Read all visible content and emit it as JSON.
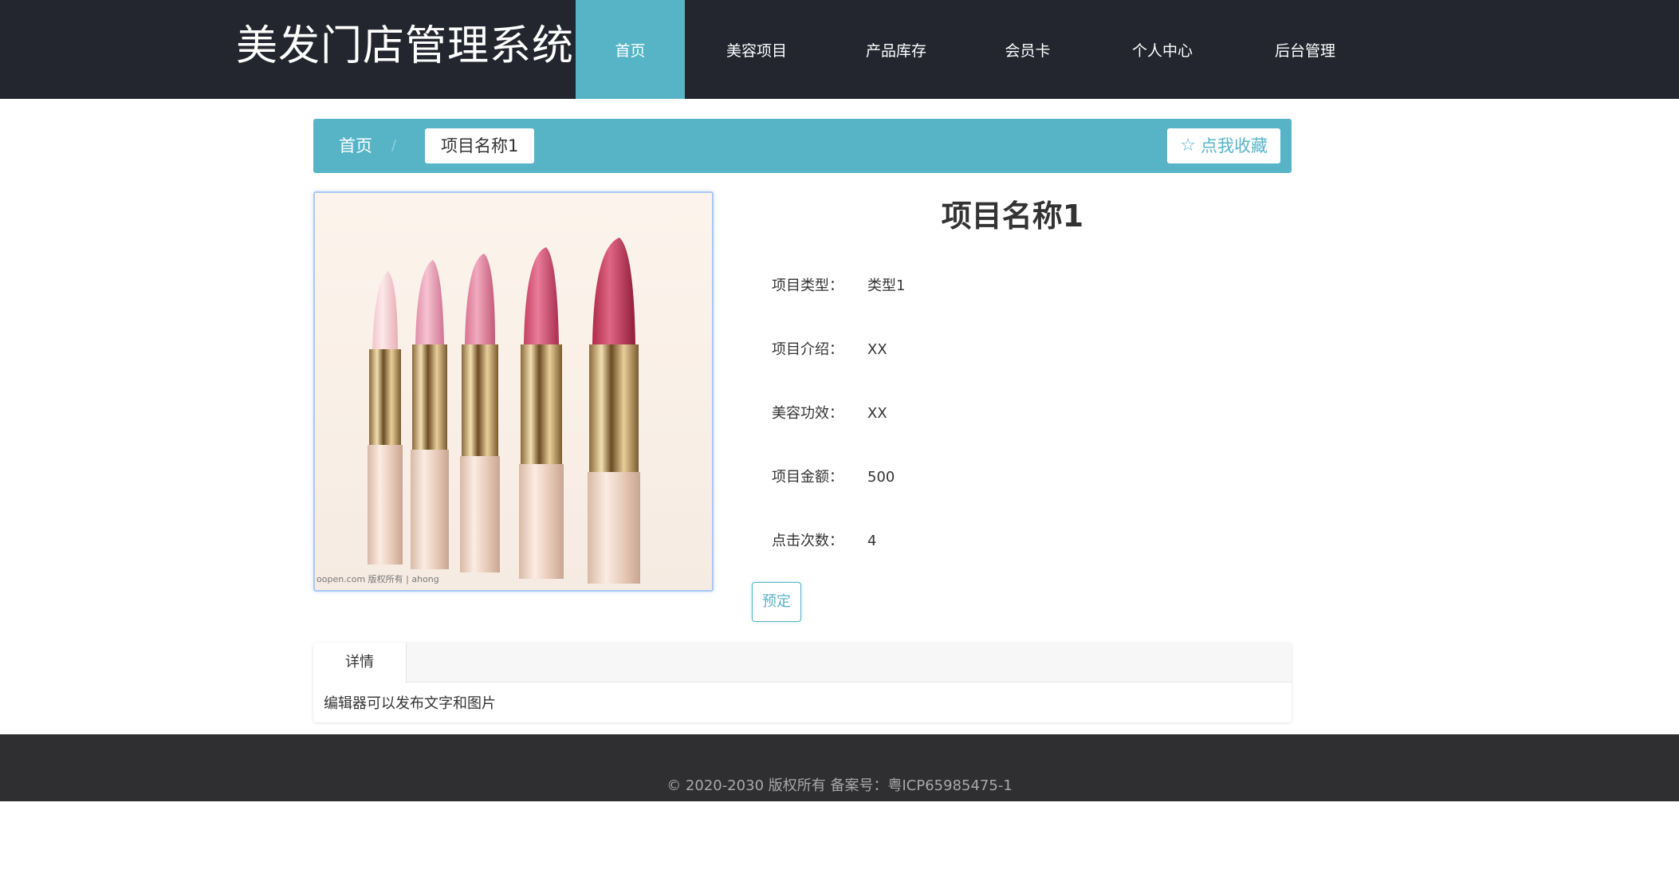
{
  "header": {
    "logo": "美发门店管理系统",
    "nav": [
      {
        "label": "首页",
        "active": true
      },
      {
        "label": "美容项目",
        "active": false
      },
      {
        "label": "产品库存",
        "active": false
      },
      {
        "label": "会员卡",
        "active": false
      },
      {
        "label": "个人中心",
        "active": false
      },
      {
        "label": "后台管理",
        "active": false
      }
    ]
  },
  "breadcrumb": {
    "home": "首页",
    "separator": "/",
    "current": "项目名称1",
    "favorite_label": "点我收藏",
    "favorite_icon": "star-outline-icon"
  },
  "product": {
    "image_watermark": "oopen.com 版权所有 | ahong",
    "title": "项目名称1",
    "fields": [
      {
        "label": "项目类型：",
        "value": "类型1"
      },
      {
        "label": "项目介绍：",
        "value": "XX"
      },
      {
        "label": "美容功效：",
        "value": "XX"
      },
      {
        "label": "项目金额：",
        "value": "500"
      },
      {
        "label": "点击次数：",
        "value": "4"
      }
    ],
    "book_label": "预定"
  },
  "tabs": {
    "active_label": "详情",
    "content": "编辑器可以发布文字和图片"
  },
  "footer": {
    "text": "© 2020-2030 版权所有 备案号：粤ICP65985475-1"
  },
  "colors": {
    "header_bg": "#23262e",
    "accent": "#57b4c7",
    "footer_bg": "#2f2f31"
  }
}
